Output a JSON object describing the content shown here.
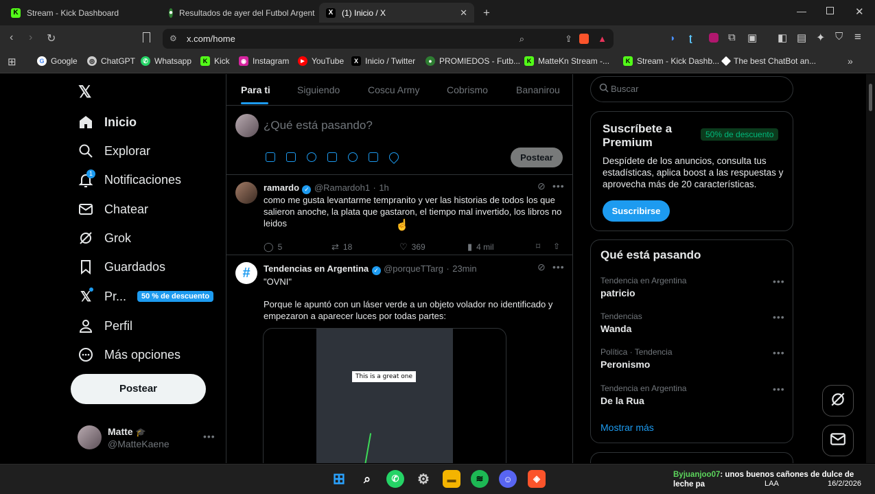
{
  "tabs": [
    {
      "label": "Stream - Kick Dashboard"
    },
    {
      "label": "Resultados de ayer del Futbol Argent"
    },
    {
      "label": "(1) Inicio / X"
    }
  ],
  "address": {
    "url": "x.com/home"
  },
  "bookmarks": [
    "Google",
    "ChatGPT",
    "Whatsapp",
    "Kick",
    "Instagram",
    "YouTube",
    "Inicio / Twitter",
    "PROMIEDOS - Futb...",
    "MatteKn Stream -...",
    "Stream - Kick Dashb...",
    "The best ChatBot an..."
  ],
  "sidebar": {
    "items": [
      {
        "label": "Inicio"
      },
      {
        "label": "Explorar"
      },
      {
        "label": "Notificaciones",
        "badge": "1"
      },
      {
        "label": "Chatear"
      },
      {
        "label": "Grok"
      },
      {
        "label": "Guardados"
      },
      {
        "label": "Pr...",
        "badge": "50 % de descuento"
      },
      {
        "label": "Perfil"
      },
      {
        "label": "Más opciones"
      }
    ],
    "post_button": "Postear",
    "profile": {
      "name": "Matte",
      "handle": "@MatteKaene"
    }
  },
  "feed": {
    "tabs": [
      "Para ti",
      "Siguiendo",
      "Coscu Army",
      "Cobrismo",
      "Bananirou"
    ],
    "compose_placeholder": "¿Qué está pasando?",
    "post_button": "Postear",
    "tweets": [
      {
        "name": "ramardo",
        "handle": "@Ramardoh1",
        "time": "1h",
        "text": "como me gusta levantarme tempranito y ver las historias de todos los que salieron anoche, la plata que gastaron, el tiempo mal invertido, los libros no leidos",
        "replies": "5",
        "retweets": "18",
        "likes": "369",
        "views": "4 mil"
      },
      {
        "name": "Tendencias en Argentina",
        "handle": "@porqueTTarg",
        "time": "23min",
        "text1": "\"OVNI\"",
        "text2": "Porque le apuntó con un láser verde a un objeto volador no identificado y empezaron a aparecer luces por todas partes:",
        "media_caption": "This is a great one"
      }
    ]
  },
  "right": {
    "search_placeholder": "Buscar",
    "premium": {
      "title": "Suscríbete a Premium",
      "badge": "50% de descuento",
      "desc": "Despídete de los anuncios, consulta tus estadísticas, aplica boost a las respuestas y aprovecha más de 20 características.",
      "button": "Suscribirse"
    },
    "trends": {
      "title": "Qué está pasando",
      "items": [
        {
          "cat": "Tendencia en Argentina",
          "name": "patricio"
        },
        {
          "cat": "Tendencias",
          "name": "Wanda"
        },
        {
          "cat": "Política · Tendencia",
          "name": "Peronismo"
        },
        {
          "cat": "Tendencia en Argentina",
          "name": "De la Rua"
        }
      ],
      "more": "Mostrar más"
    }
  },
  "taskbar": {
    "notif_user": "Byjuanjoo07",
    "notif_text": ": unos buenos cañones de dulce de leche pa",
    "lang": "LAA",
    "date": "16/2/2026"
  }
}
